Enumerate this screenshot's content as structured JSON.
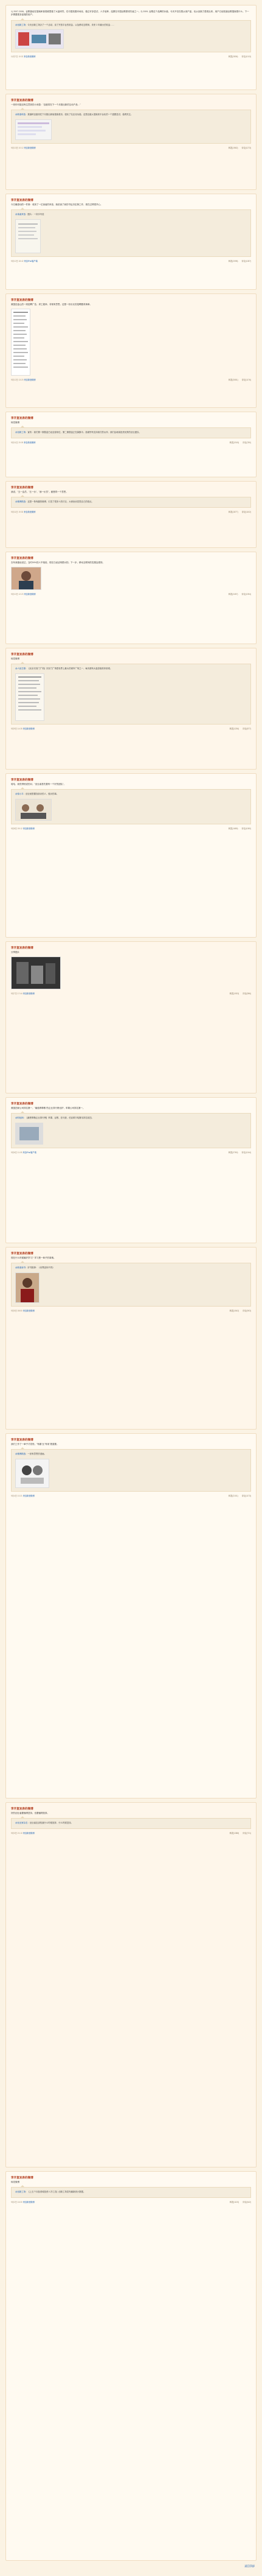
{
  "feed": {
    "author_name": "李开复发表的微博",
    "more_link": "返回顶部",
    "posts": [
      {
        "text": "1) 2007-2008，谷歌曾经在搜索和音视频里做了大量研究，在中国拓展本地化，做过许多尝试，人才培养，结果在中国谷歌是领先者之一。2) 2009, 谷歌这个品牌的价值，今天不仅仅是从用户量，也从创新力表现出来，用户已经知道谷歌搜索是什么，下一步需要更多高端的用户。",
        "quote_author": "@创新工场",
        "quote_text": "今天创新工场办了一个活动，谈了开放平台的机会，以及移动互联网，未来 3 年最大的机会……",
        "time": "11月7日 10:02",
        "source": "来自新浪微博",
        "repost": "转发(2836)",
        "comment": "评论(1013)"
      },
      {
        "text": "一则你可能没有注意到的小消息：\"百度将在下一个月推出新的互动产品…\"",
        "quote_author": "@新浪科技",
        "quote_text": "报道称百度将在下月推出新版搜索首页，强化了社区化功能。这是百度从搜索到平台化的一个重要尝试，值得关注。",
        "time": "9月13日 10:12",
        "source": "来自新浪微博",
        "repost": "转发(1562)",
        "comment": "评论(1273)"
      },
      {
        "text": "今日最感动的一件事：收到了一位读者的来信，她说读了我的书后决定换工作，现在过得很开心。",
        "quote_author": "@读者来信",
        "quote_text": "图片：一封手写信",
        "time": "9月12日 18:42",
        "source": "来自iPad客户端",
        "repost": "转发(2098)",
        "comment": "评论(1287)"
      },
      {
        "text": "美国旧金山的一则招聘广告，求工程师，非常有意思。这是一份长长的招聘要求清单。",
        "quote_author": "",
        "quote_text": "",
        "time": "9月12日 13:20",
        "source": "来自新浪微博",
        "repost": "转发(3081)",
        "comment": "评论(1176)"
      },
      {
        "text": "转发微博",
        "quote_author": "@创新工场",
        "quote_text": "宣布：我们第一期基金已经全部到位，第二期基金正在募集中。感谢所有支持我们的伙伴，我们会继续投资优秀的创业团队。",
        "time": "9月11日 20:09",
        "source": "来自新浪微博",
        "repost": "转发(2015)",
        "comment": "评论(780)"
      },
      {
        "text": "我说，\"五一会员、\"五一价\"、\"我一价员\"，都是同一个意思。",
        "quote_author": "@微博精选",
        "quote_text": "这是一条有趣的微博，引发了很多人的讨论，大家纷纷发表自己的观点。",
        "time": "9月11日 19:30",
        "source": "来自新浪微博",
        "repost": "转发(1877)",
        "comment": "评论(1102)"
      },
      {
        "text": "去年我曾经说过，当时99%的人不相信，现在已经证明是对的。下一步，移动互联网的发展会更快。",
        "quote_author": "@李开复",
        "quote_text": "",
        "time": "9月10日 12:20",
        "source": "来自新浪微博",
        "repost": "转发(2457)",
        "comment": "评论(1394)"
      },
      {
        "text": "转发微博",
        "quote_author": "@人民日报",
        "quote_text": "【北京天安门广场】天安门广场是世界上最大的城市广场之一，每天都有大量游客前来参观。",
        "time": "9月9日 14:35",
        "source": "来自新浪微博",
        "repost": "转发(1236)",
        "comment": "评论(877)"
      },
      {
        "text": "哈哈，我觉得他说的对，\"创业者首先要有一个好的团队\"。",
        "quote_author": "@徐小平",
        "quote_text": "创业就是要找到对的人，做对的事。",
        "time": "9月8日 09:12",
        "source": "来自新浪微博",
        "repost": "转发(1689)",
        "comment": "评论(1050)"
      },
      {
        "text": "分享图片",
        "quote_author": "",
        "quote_text": "",
        "time": "9月7日 17:44",
        "source": "来自新浪微博",
        "repost": "转发(1923)",
        "comment": "评论(956)"
      },
      {
        "text": "美国四家公司排名第一，\"最值得尊敬\"的企业排行榜出炉，苹果公司排名第一。",
        "quote_author": "@财经网",
        "quote_text": "【最受尊敬企业排行榜】苹果、谷歌、亚马逊、伯克希尔哈撒韦排名前四。",
        "time": "9月6日 11:05",
        "source": "来自iPad客户端",
        "repost": "转发(2760)",
        "comment": "评论(1244)"
      },
      {
        "text": "现在什么时候最好学习？学习是一辈子的事情。",
        "quote_author": "@新浪读书",
        "quote_text": "好书推荐：《世界因你不同》",
        "time": "9月5日 08:50",
        "source": "来自新浪微博",
        "repost": "转发(1542)",
        "comment": "评论(903)"
      },
      {
        "text": "我们工作了一辈子才发现，\"有趣\"比\"有用\"更重要。",
        "quote_author": "@微博精选",
        "quote_text": "一张有意思的漫画。",
        "time": "9月4日 10:21",
        "source": "来自新浪微博",
        "repost": "转发(2101)",
        "comment": "评论(1173)"
      },
      {
        "text": "好的创业者要懂得坚持，也要懂得放弃。",
        "quote_author": "@创业家杂志",
        "quote_text": "创业者应该知道什么时候放弃，什么时候坚持。",
        "time": "9月3日 21:10",
        "source": "来自新浪微博",
        "repost": "转发(1388)",
        "comment": "评论(721)"
      },
      {
        "text": "转发微博",
        "quote_author": "@创新工场",
        "quote_text": "【上五个月各领域投资人才汇总】创新工场发布最新统计数据。",
        "time": "9月2日 16:30",
        "source": "来自新浪微博",
        "repost": "转发(1120)",
        "comment": "评论(642)"
      }
    ]
  },
  "colors": {
    "background": "#fbf3e4",
    "card": "#fffaf1",
    "author": "#b33d1e",
    "link": "#2a6ab6"
  }
}
